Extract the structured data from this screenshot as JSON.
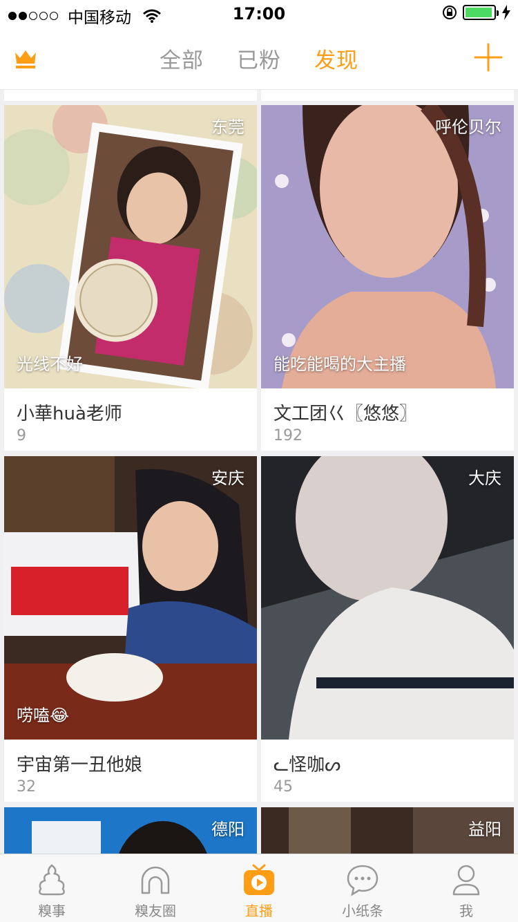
{
  "status_bar": {
    "carrier": "中国移动",
    "time": "17:00",
    "battery_level": 0.95
  },
  "header": {
    "tabs": [
      {
        "label": "全部",
        "active": false
      },
      {
        "label": "已粉",
        "active": false
      },
      {
        "label": "发现",
        "active": true
      }
    ],
    "left_icon": "crown-icon",
    "right_icon": "plus-icon"
  },
  "colors": {
    "accent": "#ff9d14",
    "inactive": "#999999",
    "background": "#f0f0f2"
  },
  "cards": [
    {
      "city": "东莞",
      "caption": "光线不好",
      "name": "小華huà老师",
      "count": "9"
    },
    {
      "city": "呼伦贝尔",
      "caption": "能吃能喝的大主播",
      "name": "文工团巜〖悠悠〗",
      "count": "192"
    },
    {
      "city": "安庆",
      "caption": "唠嗑😂",
      "name": "宇宙第一丑他娘",
      "count": "32"
    },
    {
      "city": "大庆",
      "caption": "",
      "name": "ᓚ怪咖ᔕ",
      "count": "45"
    },
    {
      "city": "德阳",
      "caption": "",
      "name": "",
      "count": ""
    },
    {
      "city": "益阳",
      "caption": "",
      "name": "",
      "count": ""
    }
  ],
  "tabbar": [
    {
      "label": "糗事",
      "icon": "poop-icon",
      "active": false
    },
    {
      "label": "糗友圈",
      "icon": "circle-arch-icon",
      "active": false
    },
    {
      "label": "直播",
      "icon": "tv-play-icon",
      "active": true
    },
    {
      "label": "小纸条",
      "icon": "chat-bubble-icon",
      "active": false
    },
    {
      "label": "我",
      "icon": "person-icon",
      "active": false
    }
  ]
}
